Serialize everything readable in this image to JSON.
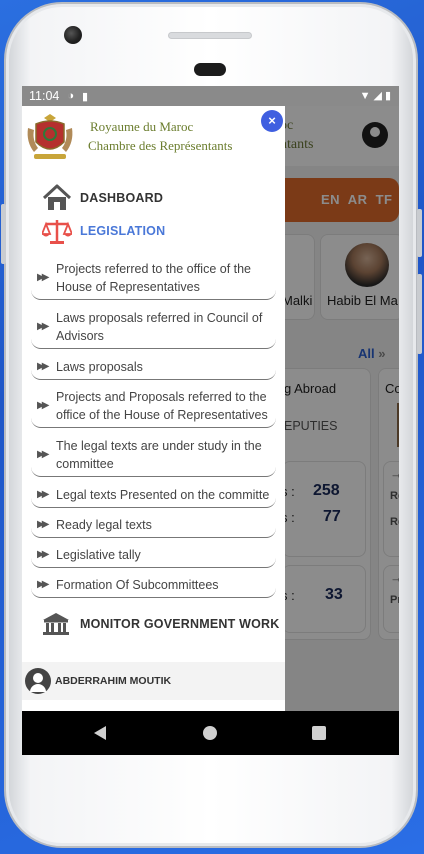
{
  "status": {
    "time": "11:04"
  },
  "background_app": {
    "header_line1": "oc",
    "header_line2": "ntants",
    "languages": "EN AR TF",
    "deputy_names": [
      "Malki",
      "Habib El Ma"
    ],
    "see_all": "All",
    "card_title_1": "g Abroad",
    "card_title_2": "Com",
    "deputies_label": "EPUTIES",
    "stat_rows": [
      {
        "label": "s :",
        "value": "258"
      },
      {
        "label": "s :",
        "value": "77"
      },
      {
        "label": "s :",
        "value": "33"
      }
    ],
    "side_labels": [
      "Re",
      "Re",
      "Pr"
    ]
  },
  "drawer": {
    "logo_line1": "Royaume du Maroc",
    "logo_line2": "Chambre des Représentants",
    "close_symbol": "×",
    "dashboard_label": "DASHBOARD",
    "legislation_label": "LEGISLATION",
    "sub_items": [
      "Projects referred to the office of the House of Representatives",
      "Laws proposals referred in Council of Advisors",
      "Laws proposals",
      "Projects and Proposals referred to the office of the House of Representatives",
      "The legal texts are under study in the committee",
      "Legal texts Presented on the committe",
      "Ready legal texts",
      "Legislative tally",
      "Formation Of Subcommittees"
    ],
    "monitor_label": "MONITOR GOVERNMENT WORK",
    "user_name": "ABDERRAHIM MOUTIK"
  },
  "colors": {
    "accent": "#4a78d8",
    "close_button": "#3f5fe0",
    "banner": "#e06a2a",
    "logo_text": "#6b7d2e"
  },
  "icons": {
    "dashboard": "home-icon",
    "legislation": "scales-icon",
    "monitor": "government-building-icon",
    "user": "user-avatar-icon"
  }
}
